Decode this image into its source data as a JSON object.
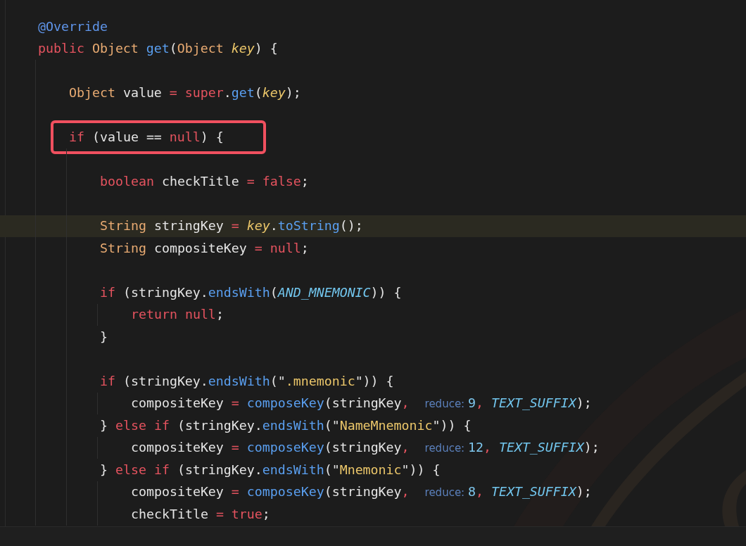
{
  "lines": [
    {
      "kind": "code",
      "current": false,
      "boxed": false,
      "tokens": [
        {
          "kind": "annotation",
          "text": "@Override"
        }
      ]
    },
    {
      "kind": "code",
      "current": false,
      "boxed": false,
      "tokens": [
        {
          "kind": "keyword",
          "text": "public "
        },
        {
          "kind": "type",
          "text": "Object "
        },
        {
          "kind": "function",
          "text": "get"
        },
        {
          "kind": "plain",
          "text": "("
        },
        {
          "kind": "type",
          "text": "Object "
        },
        {
          "kind": "param",
          "text": "key"
        },
        {
          "kind": "plain",
          "text": ") {"
        }
      ],
      "children": [
        {
          "kind": "blank"
        },
        {
          "kind": "code",
          "current": false,
          "boxed": false,
          "tokens": [
            {
              "kind": "type",
              "text": "Object"
            },
            {
              "kind": "plain",
              "text": " value "
            },
            {
              "kind": "operator",
              "text": "= "
            },
            {
              "kind": "keyword",
              "text": "super"
            },
            {
              "kind": "plain",
              "text": "."
            },
            {
              "kind": "function",
              "text": "get"
            },
            {
              "kind": "plain",
              "text": "("
            },
            {
              "kind": "param",
              "text": "key"
            },
            {
              "kind": "plain",
              "text": ");"
            }
          ]
        },
        {
          "kind": "blank"
        },
        {
          "kind": "code",
          "current": false,
          "boxed": true,
          "tokens": [
            {
              "kind": "keyword",
              "text": "if"
            },
            {
              "kind": "plain",
              "text": " (value == "
            },
            {
              "kind": "keyword",
              "text": "null"
            },
            {
              "kind": "plain",
              "text": ") {"
            }
          ],
          "children": [
            {
              "kind": "blank"
            },
            {
              "kind": "code",
              "current": false,
              "boxed": false,
              "tokens": [
                {
                  "kind": "keyword",
                  "text": "boolean"
                },
                {
                  "kind": "plain",
                  "text": " checkTitle "
                },
                {
                  "kind": "operator",
                  "text": "= "
                },
                {
                  "kind": "keyword",
                  "text": "false"
                },
                {
                  "kind": "plain",
                  "text": ";"
                }
              ]
            },
            {
              "kind": "blank"
            },
            {
              "kind": "code",
              "current": true,
              "boxed": false,
              "tokens": [
                {
                  "kind": "type",
                  "text": "String"
                },
                {
                  "kind": "plain",
                  "text": " stringKey "
                },
                {
                  "kind": "operator",
                  "text": "= "
                },
                {
                  "kind": "param",
                  "text": "key"
                },
                {
                  "kind": "plain",
                  "text": "."
                },
                {
                  "kind": "function",
                  "text": "toString"
                },
                {
                  "kind": "plain",
                  "text": "();"
                }
              ]
            },
            {
              "kind": "code",
              "current": false,
              "boxed": false,
              "tokens": [
                {
                  "kind": "type",
                  "text": "String"
                },
                {
                  "kind": "plain",
                  "text": " compositeKey "
                },
                {
                  "kind": "operator",
                  "text": "= "
                },
                {
                  "kind": "keyword",
                  "text": "null"
                },
                {
                  "kind": "plain",
                  "text": ";"
                }
              ]
            },
            {
              "kind": "blank"
            },
            {
              "kind": "code",
              "current": false,
              "boxed": false,
              "tokens": [
                {
                  "kind": "keyword",
                  "text": "if"
                },
                {
                  "kind": "plain",
                  "text": " (stringKey."
                },
                {
                  "kind": "function",
                  "text": "endsWith"
                },
                {
                  "kind": "plain",
                  "text": "("
                },
                {
                  "kind": "constant",
                  "text": "AND_MNEMONIC"
                },
                {
                  "kind": "plain",
                  "text": ")) {"
                }
              ],
              "children": [
                {
                  "kind": "code",
                  "current": false,
                  "boxed": false,
                  "tokens": [
                    {
                      "kind": "keyword",
                      "text": "return null"
                    },
                    {
                      "kind": "plain",
                      "text": ";"
                    }
                  ]
                }
              ]
            },
            {
              "kind": "code",
              "current": false,
              "boxed": false,
              "tokens": [
                {
                  "kind": "plain",
                  "text": "}"
                }
              ]
            },
            {
              "kind": "blank"
            },
            {
              "kind": "code",
              "current": false,
              "boxed": false,
              "tokens": [
                {
                  "kind": "keyword",
                  "text": "if"
                },
                {
                  "kind": "plain",
                  "text": " (stringKey."
                },
                {
                  "kind": "function",
                  "text": "endsWith"
                },
                {
                  "kind": "plain",
                  "text": "(\""
                },
                {
                  "kind": "string",
                  "text": ".mnemonic"
                },
                {
                  "kind": "plain",
                  "text": "\")) {"
                }
              ],
              "children": [
                {
                  "kind": "code",
                  "current": false,
                  "boxed": false,
                  "tokens": [
                    {
                      "kind": "plain",
                      "text": "compositeKey "
                    },
                    {
                      "kind": "operator",
                      "text": "= "
                    },
                    {
                      "kind": "function",
                      "text": "composeKey"
                    },
                    {
                      "kind": "plain",
                      "text": "(stringKey"
                    },
                    {
                      "kind": "operator",
                      "text": ",  "
                    },
                    {
                      "kind": "hint",
                      "text": "reduce: "
                    },
                    {
                      "kind": "number",
                      "text": "9"
                    },
                    {
                      "kind": "operator",
                      "text": ", "
                    },
                    {
                      "kind": "constant",
                      "text": "TEXT_SUFFIX"
                    },
                    {
                      "kind": "plain",
                      "text": ");"
                    }
                  ]
                }
              ]
            },
            {
              "kind": "code",
              "current": false,
              "boxed": false,
              "tokens": [
                {
                  "kind": "plain",
                  "text": "} "
                },
                {
                  "kind": "keyword",
                  "text": "else if"
                },
                {
                  "kind": "plain",
                  "text": " (stringKey."
                },
                {
                  "kind": "function",
                  "text": "endsWith"
                },
                {
                  "kind": "plain",
                  "text": "(\""
                },
                {
                  "kind": "string",
                  "text": "NameMnemonic"
                },
                {
                  "kind": "plain",
                  "text": "\")) {"
                }
              ],
              "children": [
                {
                  "kind": "code",
                  "current": false,
                  "boxed": false,
                  "tokens": [
                    {
                      "kind": "plain",
                      "text": "compositeKey "
                    },
                    {
                      "kind": "operator",
                      "text": "= "
                    },
                    {
                      "kind": "function",
                      "text": "composeKey"
                    },
                    {
                      "kind": "plain",
                      "text": "(stringKey"
                    },
                    {
                      "kind": "operator",
                      "text": ",  "
                    },
                    {
                      "kind": "hint",
                      "text": "reduce: "
                    },
                    {
                      "kind": "number",
                      "text": "12"
                    },
                    {
                      "kind": "operator",
                      "text": ", "
                    },
                    {
                      "kind": "constant",
                      "text": "TEXT_SUFFIX"
                    },
                    {
                      "kind": "plain",
                      "text": ");"
                    }
                  ]
                }
              ]
            },
            {
              "kind": "code",
              "current": false,
              "boxed": false,
              "tokens": [
                {
                  "kind": "plain",
                  "text": "} "
                },
                {
                  "kind": "keyword",
                  "text": "else if"
                },
                {
                  "kind": "plain",
                  "text": " (stringKey."
                },
                {
                  "kind": "function",
                  "text": "endsWith"
                },
                {
                  "kind": "plain",
                  "text": "(\""
                },
                {
                  "kind": "string",
                  "text": "Mnemonic"
                },
                {
                  "kind": "plain",
                  "text": "\")) {"
                }
              ],
              "children": [
                {
                  "kind": "code",
                  "current": false,
                  "boxed": false,
                  "tokens": [
                    {
                      "kind": "plain",
                      "text": "compositeKey "
                    },
                    {
                      "kind": "operator",
                      "text": "= "
                    },
                    {
                      "kind": "function",
                      "text": "composeKey"
                    },
                    {
                      "kind": "plain",
                      "text": "(stringKey"
                    },
                    {
                      "kind": "operator",
                      "text": ",  "
                    },
                    {
                      "kind": "hint",
                      "text": "reduce: "
                    },
                    {
                      "kind": "number",
                      "text": "8"
                    },
                    {
                      "kind": "operator",
                      "text": ", "
                    },
                    {
                      "kind": "constant",
                      "text": "TEXT_SUFFIX"
                    },
                    {
                      "kind": "plain",
                      "text": ");"
                    }
                  ]
                },
                {
                  "kind": "code",
                  "current": false,
                  "boxed": false,
                  "tokens": [
                    {
                      "kind": "plain",
                      "text": "checkTitle "
                    },
                    {
                      "kind": "operator",
                      "text": "= "
                    },
                    {
                      "kind": "keyword",
                      "text": "true"
                    },
                    {
                      "kind": "plain",
                      "text": ";"
                    }
                  ]
                }
              ]
            }
          ]
        }
      ]
    }
  ]
}
